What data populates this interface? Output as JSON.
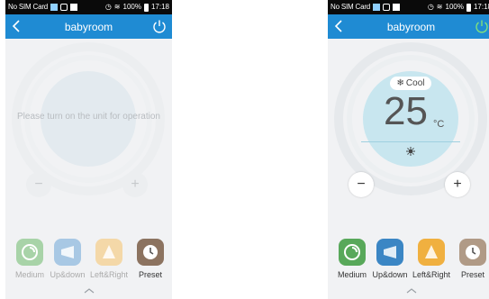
{
  "status_bar": {
    "carrier": "No SIM Card",
    "battery": "100%",
    "time": "17:18"
  },
  "header": {
    "title": "babyroom"
  },
  "screens": {
    "off": {
      "message": "Please turn on the unit for operation"
    },
    "on": {
      "mode": "Cool",
      "temperature": "25",
      "unit": "°C"
    }
  },
  "controls": {
    "minus": "−",
    "plus": "+"
  },
  "functions": [
    "Medium",
    "Up&down",
    "Left&Right",
    "Preset"
  ],
  "colors": {
    "header": "#1f8bd3",
    "medium": "#58a85a",
    "updown": "#3b86c4",
    "leftright": "#f0b040",
    "preset": "#b09a86",
    "power_on": "#7ee07e"
  }
}
